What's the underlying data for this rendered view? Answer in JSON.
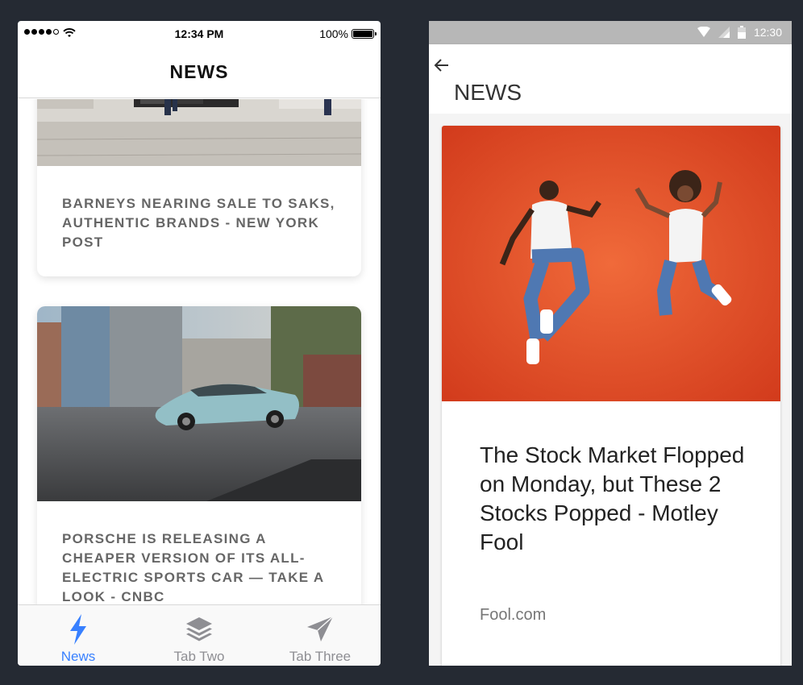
{
  "ios": {
    "status": {
      "time": "12:34 PM",
      "battery": "100%"
    },
    "header_title": "NEWS",
    "articles": [
      {
        "title": "BARNEYS NEARING SALE TO SAKS, AUTHENTIC BRANDS - NEW YORK POST"
      },
      {
        "title": "PORSCHE IS RELEASING A CHEAPER VERSION OF ITS ALL-ELECTRIC SPORTS CAR — TAKE A LOOK - CNBC"
      }
    ],
    "tabs": [
      {
        "label": "News",
        "icon": "flash-icon",
        "active": true
      },
      {
        "label": "Tab Two",
        "icon": "layers-icon",
        "active": false
      },
      {
        "label": "Tab Three",
        "icon": "send-icon",
        "active": false
      }
    ],
    "accent_color": "#3880ff"
  },
  "android": {
    "status": {
      "time": "12:30"
    },
    "header_title": "NEWS",
    "article": {
      "title": "The Stock Market Flopped on Monday, but These 2 Stocks Popped - Motley Fool",
      "source": "Fool.com"
    }
  }
}
